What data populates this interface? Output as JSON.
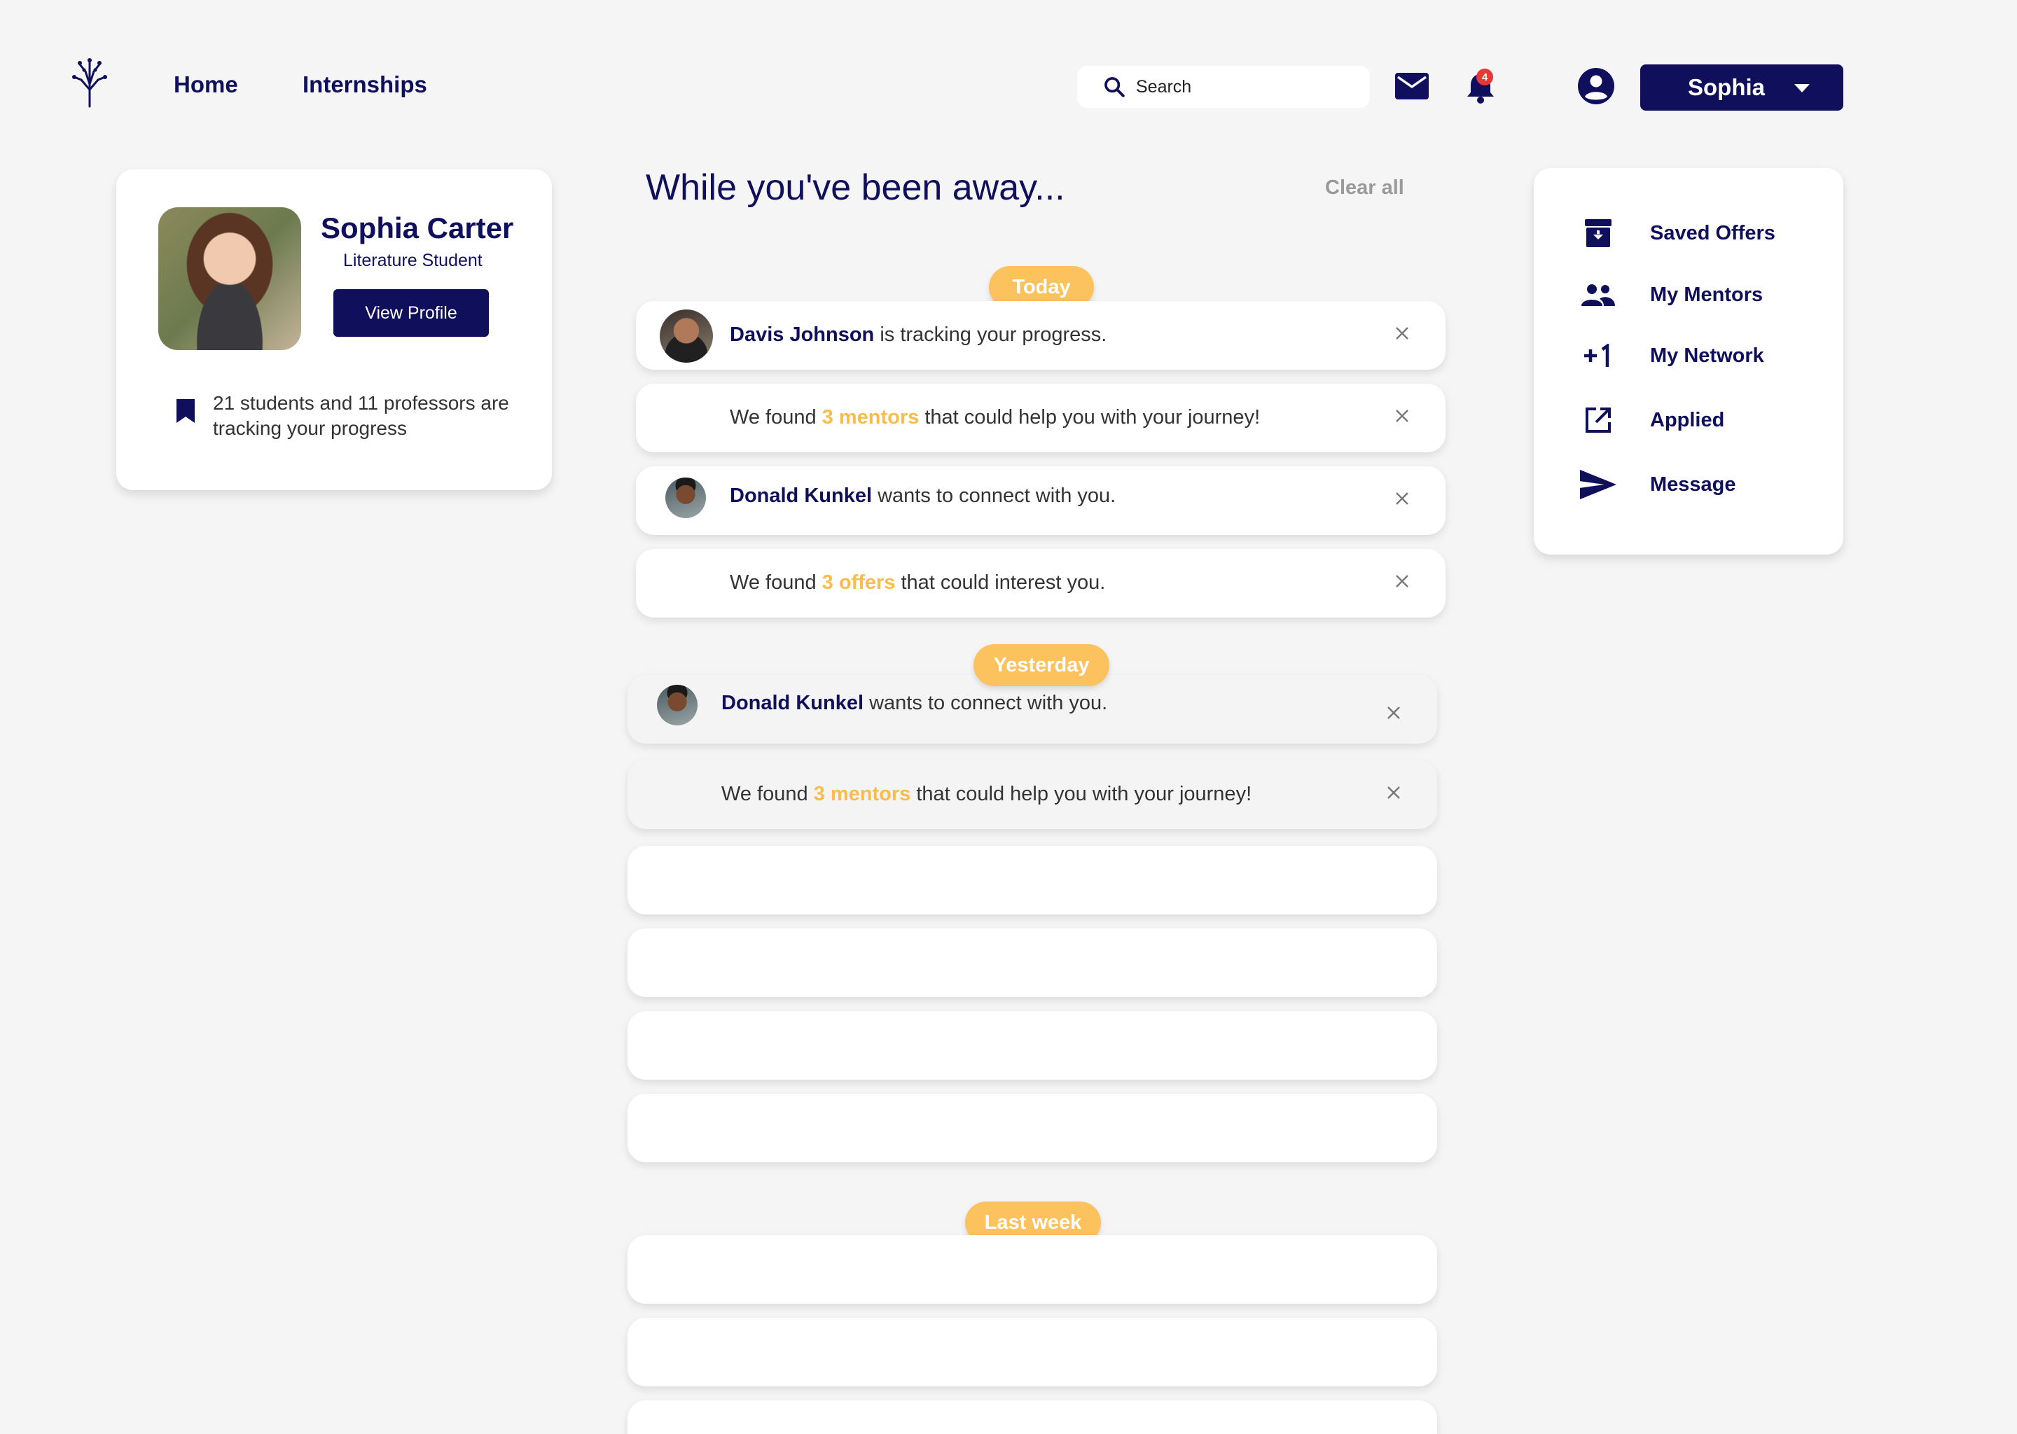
{
  "header": {
    "nav": [
      "Home",
      "Internships"
    ],
    "search_placeholder": "Search",
    "notification_count": "4",
    "user_button": "Sophia"
  },
  "profile": {
    "name": "Sophia Carter",
    "role": "Literature Student",
    "view_profile": "View Profile",
    "tracking": "21 students and 11 professors are tracking your progress"
  },
  "feed": {
    "title": "While you've been away...",
    "clear_all": "Clear all",
    "groups": [
      "Today",
      "Yesterday",
      "Last week"
    ],
    "items": [
      {
        "name": "Davis Johnson",
        "text": " is tracking your progress."
      },
      {
        "pre": "We found ",
        "hl": "3 mentors",
        "post": " that could help you with your journey!"
      },
      {
        "name": "Donald Kunkel",
        "text": "  wants to connect with you."
      },
      {
        "pre": "We found ",
        "hl": "3 offers",
        "post": " that could interest you."
      },
      {
        "name": "Donald Kunkel",
        "text": "  wants to connect with you."
      },
      {
        "pre": "We found ",
        "hl": "3 mentors",
        "post": " that could help you with your journey!"
      }
    ]
  },
  "sidebar": {
    "items": [
      {
        "label": "Saved Offers",
        "icon": "archive-icon"
      },
      {
        "label": "My Mentors",
        "icon": "people-icon"
      },
      {
        "label": "My Network",
        "icon": "plus-one-icon"
      },
      {
        "label": "Applied",
        "icon": "open-in-new-icon"
      },
      {
        "label": "Message",
        "icon": "send-icon"
      }
    ]
  },
  "colors": {
    "navy": "#0f0f5c",
    "accent": "#fcc25e",
    "background": "#f5f5f6"
  }
}
